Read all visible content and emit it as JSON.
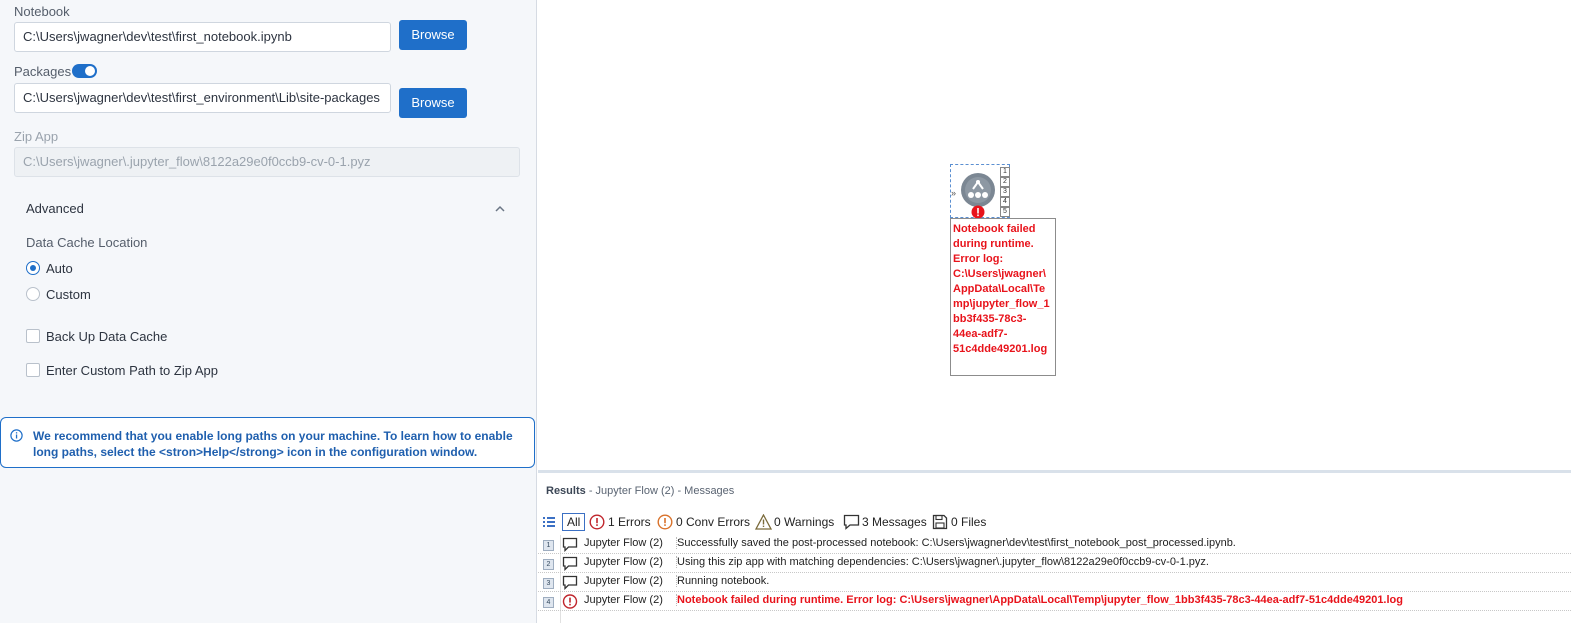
{
  "config": {
    "notebook_label": "Notebook",
    "notebook_value": "C:\\Users\\jwagner\\dev\\test\\first_notebook.ipynb",
    "browse_label": "Browse",
    "packages_label": "Packages",
    "packages_toggle": "on",
    "packages_value": "C:\\Users\\jwagner\\dev\\test\\first_environment\\Lib\\site-packages",
    "zipapp_label": "Zip App",
    "zipapp_value": "C:\\Users\\jwagner\\.jupyter_flow\\8122a29e0f0ccb9-cv-0-1.pyz",
    "advanced_label": "Advanced",
    "cache_location_label": "Data Cache Location",
    "radio_auto": "Auto",
    "radio_custom": "Custom",
    "selected_cache_option": "Auto",
    "backup_label": "Back Up Data Cache",
    "custom_zip_label": "Enter Custom Path to Zip App",
    "notice": "We recommend that you enable long paths on your machine. To learn how to enable long paths, select the <stron>Help</strong> icon in the configuration window."
  },
  "canvas": {
    "tool_icon": "jupyter-flow-gear-icon",
    "ports": [
      "1",
      "2",
      "3",
      "4",
      "5"
    ],
    "error_annotation": "Notebook failed during runtime. Error log: C:\\Users\\jwagner\\AppData\\Local\\Temp\\jupyter_flow_1bb3f435-78c3-44ea-adf7-51c4dde49201.log"
  },
  "results": {
    "title": "Results",
    "subtitle": "- Jupyter Flow (2) - Messages",
    "filters": {
      "all": "All",
      "errors": "1 Errors",
      "conv_errors": "0 Conv Errors",
      "warnings": "0 Warnings",
      "messages": "3 Messages",
      "files": "0 Files"
    },
    "rows": [
      {
        "num": "1",
        "type": "message",
        "source": "Jupyter Flow (2)",
        "text": "Successfully saved the post-processed notebook: C:\\Users\\jwagner\\dev\\test\\first_notebook_post_processed.ipynb."
      },
      {
        "num": "2",
        "type": "message",
        "source": "Jupyter Flow (2)",
        "text": "Using this zip app with matching dependencies: C:\\Users\\jwagner\\.jupyter_flow\\8122a29e0f0ccb9-cv-0-1.pyz."
      },
      {
        "num": "3",
        "type": "message",
        "source": "Jupyter Flow (2)",
        "text": "Running notebook."
      },
      {
        "num": "4",
        "type": "error",
        "source": "Jupyter Flow (2)",
        "text": "Notebook failed during runtime. Error log: C:\\Users\\jwagner\\AppData\\Local\\Temp\\jupyter_flow_1bb3f435-78c3-44ea-adf7-51c4dde49201.log"
      }
    ]
  },
  "colors": {
    "accent": "#1f6fc9",
    "error": "#e8131b"
  }
}
